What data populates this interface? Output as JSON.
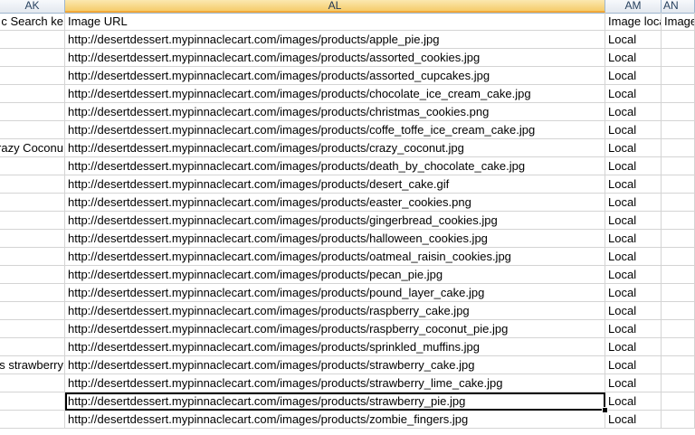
{
  "columns": {
    "ak": "AK",
    "al": "AL",
    "am": "AM",
    "an": "AN"
  },
  "header_row": {
    "ak": "c Search ke",
    "al": "Image URL",
    "am": "Image loca",
    "an": "Image"
  },
  "rows": [
    {
      "ak": "",
      "url": "http://desertdessert.mypinnaclecart.com/images/products/apple_pie.jpg",
      "location": "Local"
    },
    {
      "ak": "",
      "url": "http://desertdessert.mypinnaclecart.com/images/products/assorted_cookies.jpg",
      "location": "Local"
    },
    {
      "ak": "",
      "url": "http://desertdessert.mypinnaclecart.com/images/products/assorted_cupcakes.jpg",
      "location": "Local"
    },
    {
      "ak": "",
      "url": "http://desertdessert.mypinnaclecart.com/images/products/chocolate_ice_cream_cake.jpg",
      "location": "Local"
    },
    {
      "ak": "",
      "url": "http://desertdessert.mypinnaclecart.com/images/products/christmas_cookies.png",
      "location": "Local"
    },
    {
      "ak": "",
      "url": "http://desertdessert.mypinnaclecart.com/images/products/coffe_toffe_ice_cream_cake.jpg",
      "location": "Local"
    },
    {
      "ak": "razy Coconu",
      "url": "http://desertdessert.mypinnaclecart.com/images/products/crazy_coconut.jpg",
      "location": "Local"
    },
    {
      "ak": "",
      "url": "http://desertdessert.mypinnaclecart.com/images/products/death_by_chocolate_cake.jpg",
      "location": "Local"
    },
    {
      "ak": "",
      "url": "http://desertdessert.mypinnaclecart.com/images/products/desert_cake.gif",
      "location": "Local"
    },
    {
      "ak": "",
      "url": "http://desertdessert.mypinnaclecart.com/images/products/easter_cookies.png",
      "location": "Local"
    },
    {
      "ak": "",
      "url": "http://desertdessert.mypinnaclecart.com/images/products/gingerbread_cookies.jpg",
      "location": "Local"
    },
    {
      "ak": "",
      "url": "http://desertdessert.mypinnaclecart.com/images/products/halloween_cookies.jpg",
      "location": "Local"
    },
    {
      "ak": "",
      "url": "http://desertdessert.mypinnaclecart.com/images/products/oatmeal_raisin_cookies.jpg",
      "location": "Local"
    },
    {
      "ak": "",
      "url": "http://desertdessert.mypinnaclecart.com/images/products/pecan_pie.jpg",
      "location": "Local"
    },
    {
      "ak": "",
      "url": "http://desertdessert.mypinnaclecart.com/images/products/pound_layer_cake.jpg",
      "location": "Local"
    },
    {
      "ak": "",
      "url": "http://desertdessert.mypinnaclecart.com/images/products/raspberry_cake.jpg",
      "location": "Local"
    },
    {
      "ak": "",
      "url": "http://desertdessert.mypinnaclecart.com/images/products/raspberry_coconut_pie.jpg",
      "location": "Local"
    },
    {
      "ak": "",
      "url": "http://desertdessert.mypinnaclecart.com/images/products/sprinkled_muffins.jpg",
      "location": "Local"
    },
    {
      "ak": "s strawberry",
      "url": "http://desertdessert.mypinnaclecart.com/images/products/strawberry_cake.jpg",
      "location": "Local"
    },
    {
      "ak": "",
      "url": "http://desertdessert.mypinnaclecart.com/images/products/strawberry_lime_cake.jpg",
      "location": "Local"
    },
    {
      "ak": "",
      "url": "http://desertdessert.mypinnaclecart.com/images/products/strawberry_pie.jpg",
      "location": "Local",
      "active": true
    },
    {
      "ak": "",
      "url": "http://desertdessert.mypinnaclecart.com/images/products/zombie_fingers.jpg",
      "location": "Local"
    }
  ]
}
